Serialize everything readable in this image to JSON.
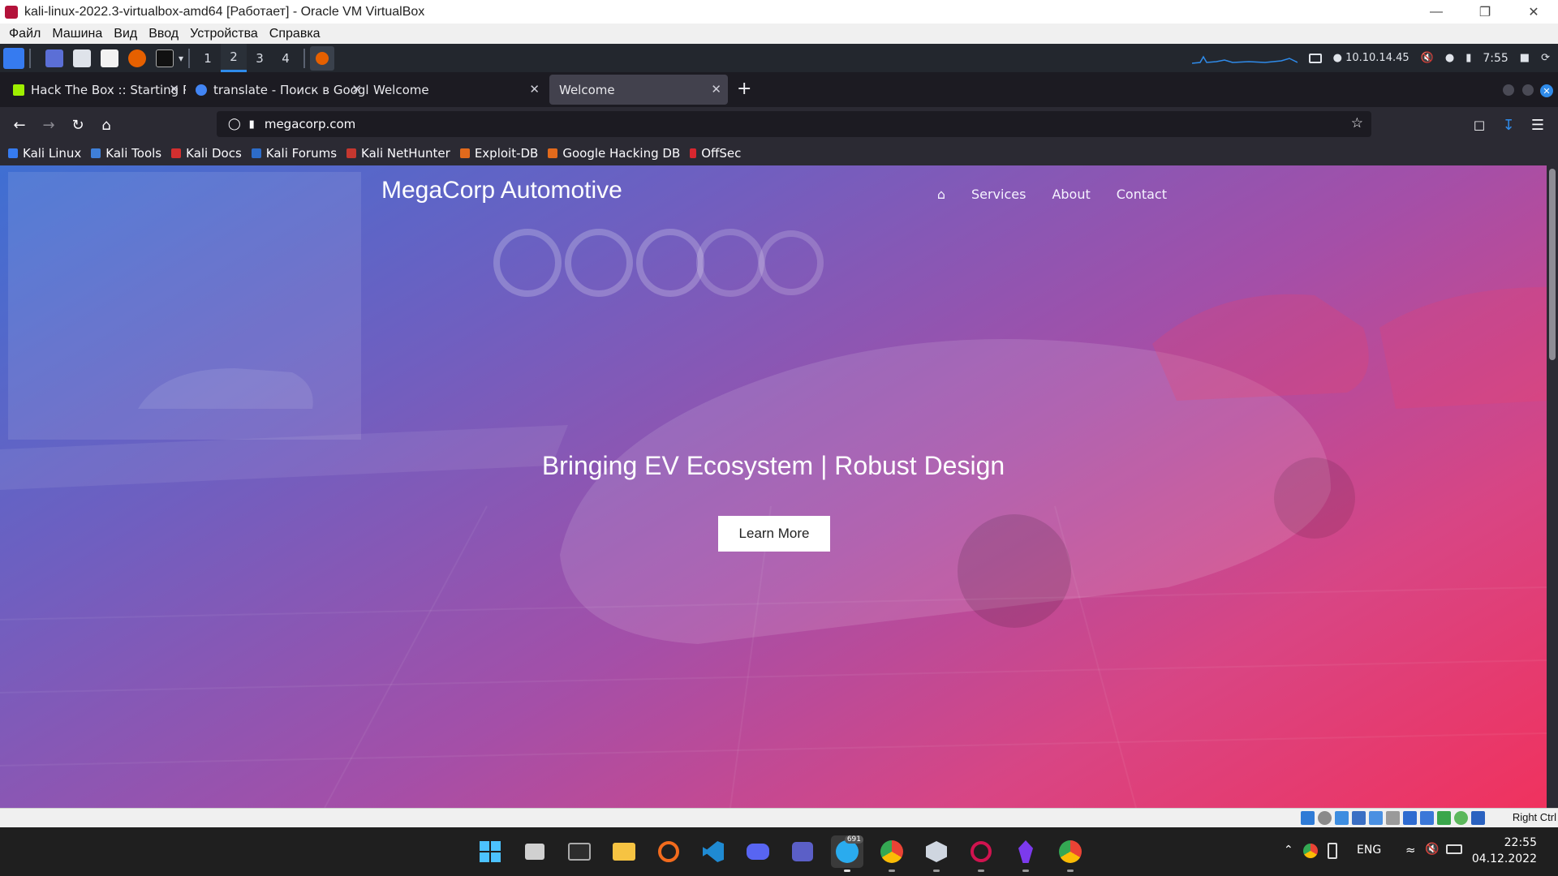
{
  "vbox": {
    "title": "kali-linux-2022.3-virtualbox-amd64 [Работает] - Oracle VM VirtualBox",
    "menu": [
      "Файл",
      "Машина",
      "Вид",
      "Ввод",
      "Устройства",
      "Справка"
    ],
    "host_key": "Right Ctrl"
  },
  "kali": {
    "workspaces": [
      "1",
      "2",
      "3",
      "4"
    ],
    "active_workspace": "2",
    "ip": "10.10.14.45",
    "time": "7:55"
  },
  "browser": {
    "tabs": [
      {
        "title": "Hack The Box :: Starting P",
        "favicon_color": "#9fef00",
        "selected": false
      },
      {
        "title": "translate - Поиск в Googl",
        "favicon_color": "#4285f4",
        "selected": false
      },
      {
        "title": "Welcome",
        "favicon_color": "",
        "selected": false
      },
      {
        "title": "Welcome",
        "favicon_color": "",
        "selected": true
      }
    ],
    "new_tab": "+",
    "url": "megacorp.com",
    "bookmarks": [
      {
        "label": "Kali Linux",
        "color": "#367bf0"
      },
      {
        "label": "Kali Tools",
        "color": "#3f7fd8"
      },
      {
        "label": "Kali Docs",
        "color": "#d22f2f"
      },
      {
        "label": "Kali Forums",
        "color": "#2d6cc9"
      },
      {
        "label": "Kali NetHunter",
        "color": "#c5372f"
      },
      {
        "label": "Exploit-DB",
        "color": "#e26a1c"
      },
      {
        "label": "Google Hacking DB",
        "color": "#e26a1c"
      },
      {
        "label": "OffSec",
        "color": "#d8272f"
      }
    ]
  },
  "site": {
    "brand": "MegaCorp Automotive",
    "nav": [
      "Services",
      "About",
      "Contact"
    ],
    "hero_title": "Bringing EV Ecosystem | Robust Design",
    "cta": "Learn More"
  },
  "taskbar": {
    "telegram_badge": "691",
    "language": "ENG",
    "time": "22:55",
    "date": "04.12.2022"
  }
}
